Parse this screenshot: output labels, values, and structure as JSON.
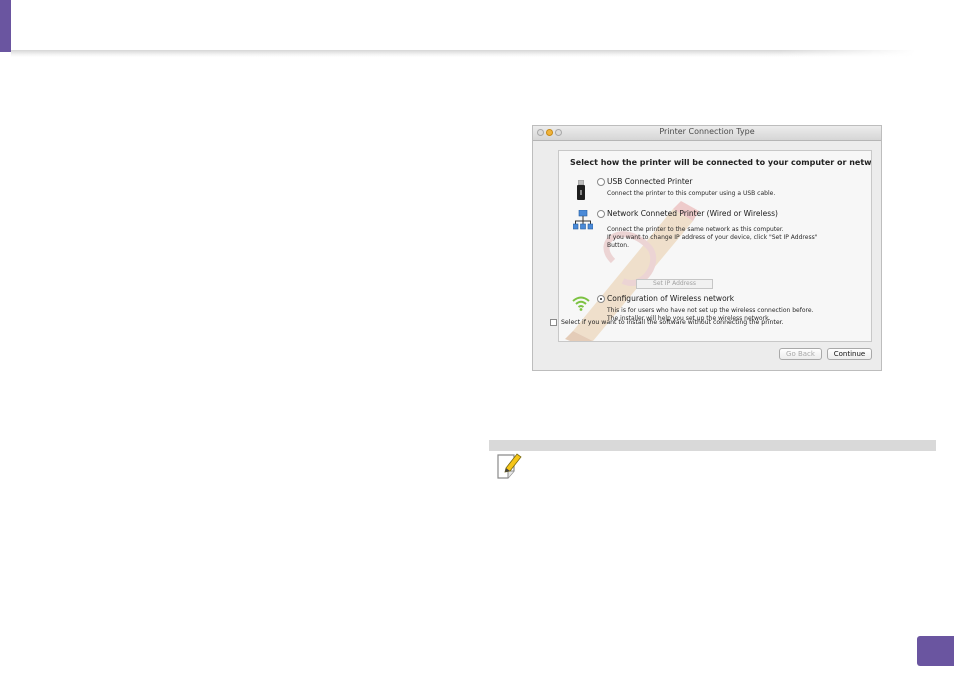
{
  "window": {
    "title": "Printer Connection Type",
    "heading": "Select how the printer will be connected to your computer or network."
  },
  "options": [
    {
      "label": "USB Connected Printer",
      "description_lines": [
        "Connect the printer to this computer using a USB cable."
      ],
      "selected": false,
      "icon": "usb-icon"
    },
    {
      "label": "Network Conneted Printer (Wired or Wireless)",
      "description_lines": [
        "Connect the printer to the same network as this computer.",
        "If you want to change IP address of your device, click \"Set IP Address\"",
        "Button."
      ],
      "selected": false,
      "icon": "network-icon",
      "button_label": "Set IP Address"
    },
    {
      "label": "Configuration of Wireless network",
      "description_lines": [
        "This is for users who have not set up the wireless connection before.",
        "The installer will help you set up the wireless network."
      ],
      "selected": true,
      "icon": "wifi-icon"
    }
  ],
  "checkbox": {
    "label": "Select if you want to install the software without connecting the printer.",
    "checked": false
  },
  "buttons": {
    "back": "Go Back",
    "continue": "Continue"
  },
  "colors": {
    "accent": "#6a55a0",
    "wifi": "#7cc242",
    "note_icon": "#f5c518"
  }
}
